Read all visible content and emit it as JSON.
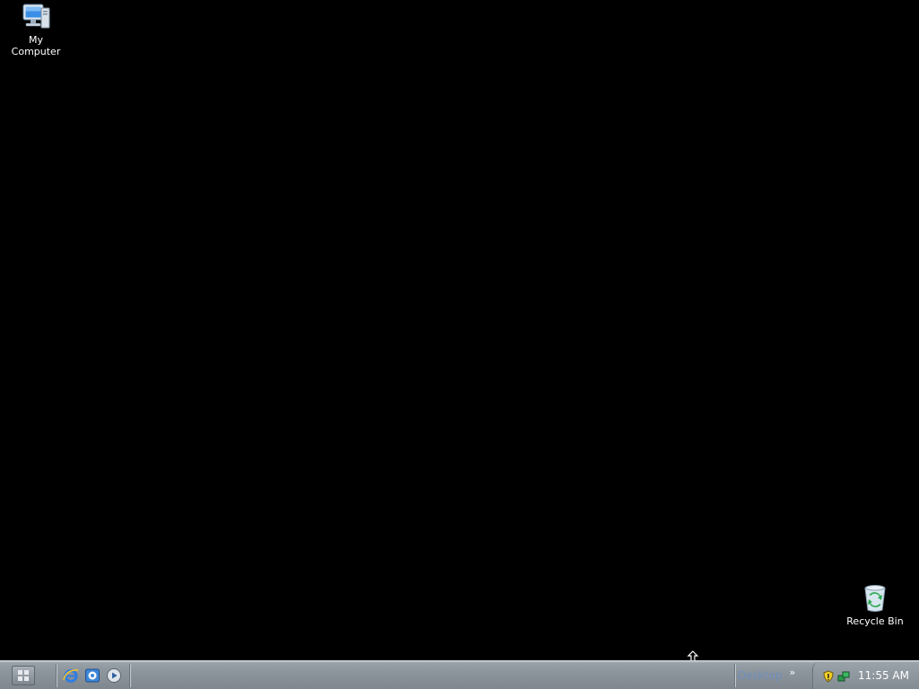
{
  "desktop": {
    "icons": [
      {
        "id": "my-computer",
        "label": "My\nComputer",
        "icon": "my-computer-icon"
      },
      {
        "id": "recycle-bin",
        "label": "Recycle Bin",
        "icon": "recycle-bin-icon"
      }
    ]
  },
  "taskbar": {
    "start_icon": "start-grid-icon",
    "quick_launch": [
      {
        "name": "Internet Explorer",
        "icon": "internet-explorer-icon"
      },
      {
        "name": "Outlook Express",
        "icon": "outlook-express-icon"
      },
      {
        "name": "Windows Media Player",
        "icon": "media-player-icon"
      }
    ],
    "desktop_toolbar": {
      "label": "Desktop",
      "chevron": "»"
    },
    "tray": {
      "icons": [
        "security-shield-icon",
        "network-icon"
      ],
      "clock": "11:55 AM"
    }
  },
  "colors": {
    "desktop_background": "#000000",
    "taskbar": "#8c949c",
    "desktop_toolbar_text": "#6e8fbd"
  }
}
